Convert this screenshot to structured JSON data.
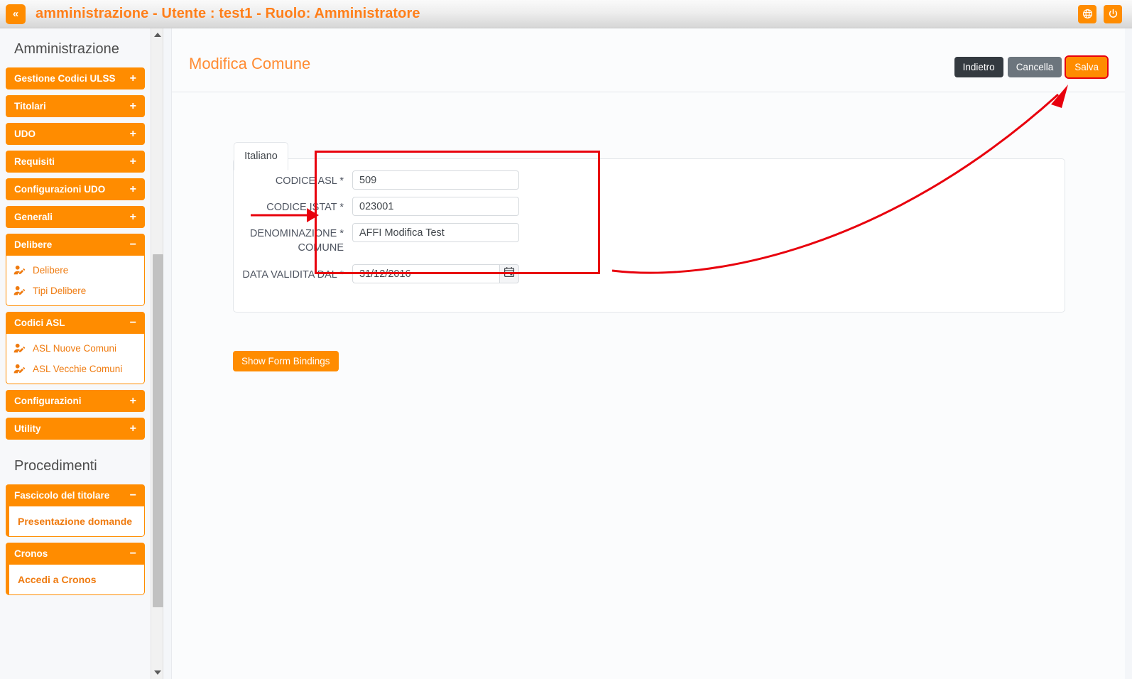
{
  "topbar": {
    "collapse_icon": "double-chevron-left-icon",
    "title": "amministrazione - Utente : test1 - Ruolo: Amministratore",
    "language_icon": "globe-icon",
    "logout_icon": "power-icon",
    "accent_color": "#ff8c00",
    "title_color": "#ff7f1a"
  },
  "sidebar": {
    "sections": [
      {
        "title": "Amministrazione",
        "groups": [
          {
            "label": "Gestione Codici ULSS",
            "sign": "+",
            "open": false,
            "items": []
          },
          {
            "label": "Titolari",
            "sign": "+",
            "open": false,
            "items": []
          },
          {
            "label": "UDO",
            "sign": "+",
            "open": false,
            "items": []
          },
          {
            "label": "Requisiti",
            "sign": "+",
            "open": false,
            "items": []
          },
          {
            "label": "Configurazioni UDO",
            "sign": "+",
            "open": false,
            "items": []
          },
          {
            "label": "Generali",
            "sign": "+",
            "open": false,
            "items": []
          },
          {
            "label": "Delibere",
            "sign": "−",
            "open": true,
            "items": [
              {
                "label": "Delibere",
                "icon": "user-edit-icon",
                "bold": false
              },
              {
                "label": "Tipi Delibere",
                "icon": "user-edit-icon",
                "bold": false
              }
            ]
          },
          {
            "label": "Codici ASL",
            "sign": "−",
            "open": true,
            "items": [
              {
                "label": "ASL Nuove Comuni",
                "icon": "user-edit-icon",
                "bold": false
              },
              {
                "label": "ASL Vecchie Comuni",
                "icon": "user-edit-icon",
                "bold": false
              }
            ]
          },
          {
            "label": "Configurazioni",
            "sign": "+",
            "open": false,
            "items": []
          },
          {
            "label": "Utility",
            "sign": "+",
            "open": false,
            "items": []
          }
        ]
      },
      {
        "title": "Procedimenti",
        "groups": [
          {
            "label": "Fascicolo del titolare",
            "sign": "−",
            "open": true,
            "items": [
              {
                "label": "Presentazione domande",
                "icon": "",
                "bold": true
              }
            ]
          },
          {
            "label": "Cronos",
            "sign": "−",
            "open": true,
            "items": [
              {
                "label": "Accedi a Cronos",
                "icon": "",
                "bold": true
              }
            ]
          }
        ]
      }
    ],
    "scrollbar": {
      "up_icon": "triangle-up-icon",
      "down_icon": "triangle-down-icon"
    }
  },
  "page": {
    "title": "Modifica Comune",
    "buttons": [
      {
        "label": "Indietro",
        "style": "dark",
        "highlighted": false
      },
      {
        "label": "Cancella",
        "style": "grey",
        "highlighted": false
      },
      {
        "label": "Salva",
        "style": "orange",
        "highlighted": true
      }
    ],
    "tab_label": "Italiano",
    "fields": [
      {
        "label": "CODICE ASL *",
        "value": "509",
        "type": "text"
      },
      {
        "label": "CODICE ISTAT *",
        "value": "023001",
        "type": "text"
      },
      {
        "label": "DENOMINAZIONE *\nCOMUNE",
        "value": "AFFI Modifica Test",
        "type": "text"
      },
      {
        "label": "DATA VALIDITA DAL *",
        "value": "31/12/2016",
        "type": "date",
        "icon": "calendar-icon"
      }
    ],
    "show_bindings_label": "Show Form Bindings"
  },
  "annotation": {
    "color": "#e8000d",
    "straight_arrow": "points-at-form-box",
    "curved_arrow": "points-at-salva-button",
    "box": "highlights-form-fields"
  }
}
